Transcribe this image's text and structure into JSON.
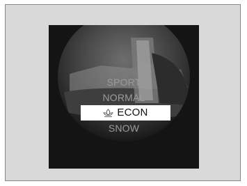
{
  "mode_menu": {
    "items": [
      {
        "label": "SPORT",
        "selected": false
      },
      {
        "label": "NORMAL",
        "selected": false
      },
      {
        "label": "ECON",
        "selected": true,
        "icon": "econ-leaf-icon"
      },
      {
        "label": "SNOW",
        "selected": false
      }
    ]
  },
  "colors": {
    "frame_background": "#d9d9d9",
    "display_background": "#141414",
    "selected_highlight": "#ffffff",
    "selected_text": "#111111",
    "unselected_text": "#9c9c9c"
  }
}
